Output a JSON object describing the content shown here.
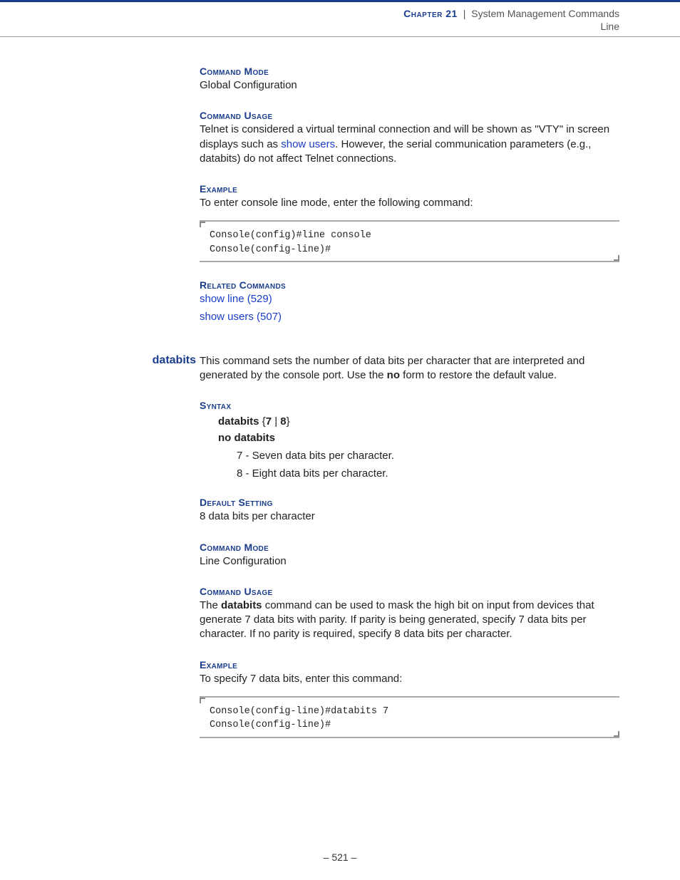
{
  "header": {
    "chapter_label": "Chapter 21",
    "separator": "|",
    "title": "System Management Commands",
    "subtitle": "Line"
  },
  "sec1": {
    "cmd_mode_h": "Command Mode",
    "cmd_mode_t": "Global Configuration",
    "cmd_usage_h": "Command Usage",
    "cmd_usage_pre": "Telnet is considered a virtual terminal connection and will be shown as \"VTY\" in screen displays such as ",
    "cmd_usage_link": "show users",
    "cmd_usage_post": ". However, the serial communication parameters (e.g., databits) do not affect Telnet connections.",
    "example_h": "Example",
    "example_t": "To enter console line mode, enter the following command:",
    "code": "Console(config)#line console\nConsole(config-line)#",
    "related_h": "Related Commands",
    "related1": "show line (529)",
    "related2": "show users (507)"
  },
  "sec2": {
    "label": "databits",
    "intro_pre": "This command sets the number of data bits per character that are interpreted and generated by the console port. Use the ",
    "intro_bold": "no",
    "intro_post": " form to restore the default value.",
    "syntax_h": "Syntax",
    "syntax1_a": "databits",
    "syntax1_b": " {",
    "syntax1_c": "7",
    "syntax1_d": " | ",
    "syntax1_e": "8",
    "syntax1_f": "}",
    "syntax2": "no databits",
    "desc7": "7 - Seven data bits per character.",
    "desc8": "8 - Eight data bits per character.",
    "default_h": "Default Setting",
    "default_t": "8 data bits per character",
    "cmd_mode_h": "Command Mode",
    "cmd_mode_t": "Line Configuration",
    "cmd_usage_h": "Command Usage",
    "cmd_usage_pre": "The ",
    "cmd_usage_bold": "databits",
    "cmd_usage_post": " command can be used to mask the high bit on input from devices that generate 7 data bits with parity. If parity is being generated, specify 7 data bits per character. If no parity is required, specify 8 data bits per character.",
    "example_h": "Example",
    "example_t": "To specify 7 data bits, enter this command:",
    "code": "Console(config-line)#databits 7\nConsole(config-line)#"
  },
  "pagenum": "–  521  –"
}
